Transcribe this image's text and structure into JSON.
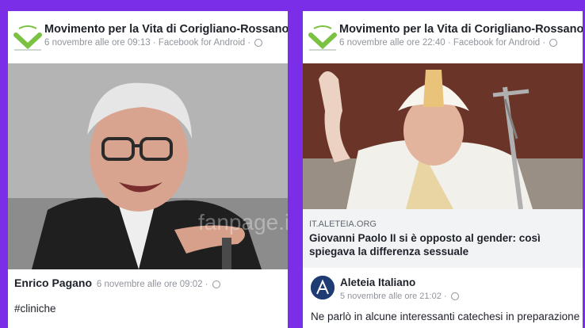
{
  "left_post": {
    "page_name": "Movimento per la Vita di Corigliano-Rossano",
    "meta": "6 novembre alle ore 09:13 · Facebook for Android ·",
    "photo_watermark": "fanpage.it",
    "comment": {
      "author": "Enrico Pagano",
      "meta": "6 novembre alle ore 09:02 ·",
      "text": "#cliniche"
    }
  },
  "right_post": {
    "page_name": "Movimento per la Vita di Corigliano-Rossano",
    "meta": "6 novembre alle ore 22:40 · Facebook for Android ·",
    "link": {
      "domain": "IT.ALETEIA.ORG",
      "title": "Giovanni Paolo II si è opposto al gender: così spiegava la differenza sessuale"
    },
    "shared": {
      "author": "Aleteia Italiano",
      "meta": "5 novembre alle ore 21:02 ·",
      "text": "Ne parlò in alcune interessanti catechesi in preparazione"
    }
  },
  "colors": {
    "background": "#7b2ee8",
    "logo_green": "#7cc242"
  }
}
